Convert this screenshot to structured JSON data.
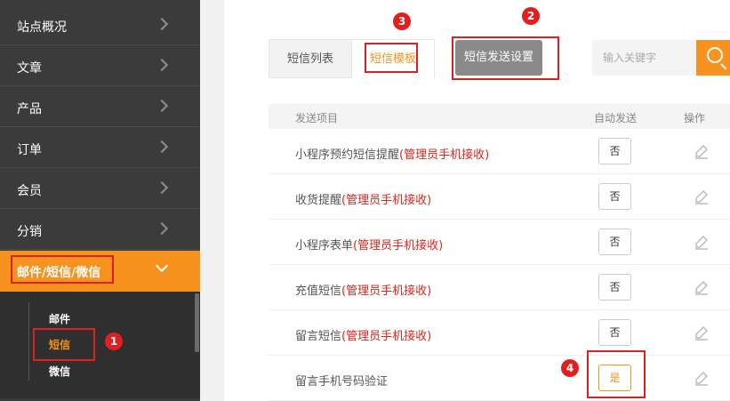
{
  "sidebar": {
    "items": [
      {
        "label": "站点概况"
      },
      {
        "label": "文章"
      },
      {
        "label": "产品"
      },
      {
        "label": "订单"
      },
      {
        "label": "会员"
      },
      {
        "label": "分销"
      },
      {
        "label": "邮件/短信/微信"
      }
    ],
    "subitems": [
      {
        "label": "邮件"
      },
      {
        "label": "短信"
      },
      {
        "label": "微信"
      }
    ]
  },
  "tabs": {
    "list": "短信列表",
    "template": "短信模板",
    "send_settings": "短信发送设置"
  },
  "search": {
    "placeholder": "输入关键字"
  },
  "table": {
    "headers": {
      "item": "发送项目",
      "auto_send": "自动发送",
      "action": "操作"
    },
    "rows": [
      {
        "name": "小程序预约短信提醒",
        "note": "(管理员手机接收)",
        "auto": "否"
      },
      {
        "name": "收货提醒",
        "note": "(管理员手机接收)",
        "auto": "否"
      },
      {
        "name": "小程序表单",
        "note": "(管理员手机接收)",
        "auto": "否"
      },
      {
        "name": "充值短信",
        "note": "(管理员手机接收)",
        "auto": "否"
      },
      {
        "name": "留言短信",
        "note": "(管理员手机接收)",
        "auto": "否"
      },
      {
        "name": "留言手机号码验证",
        "note": "",
        "auto": "是"
      }
    ]
  },
  "annotations": [
    "1",
    "2",
    "3",
    "4"
  ],
  "colors": {
    "accent": "#f7921e",
    "sidebar": "#3b3b3b",
    "annotation": "#e02020",
    "note_red": "#d8261c"
  }
}
